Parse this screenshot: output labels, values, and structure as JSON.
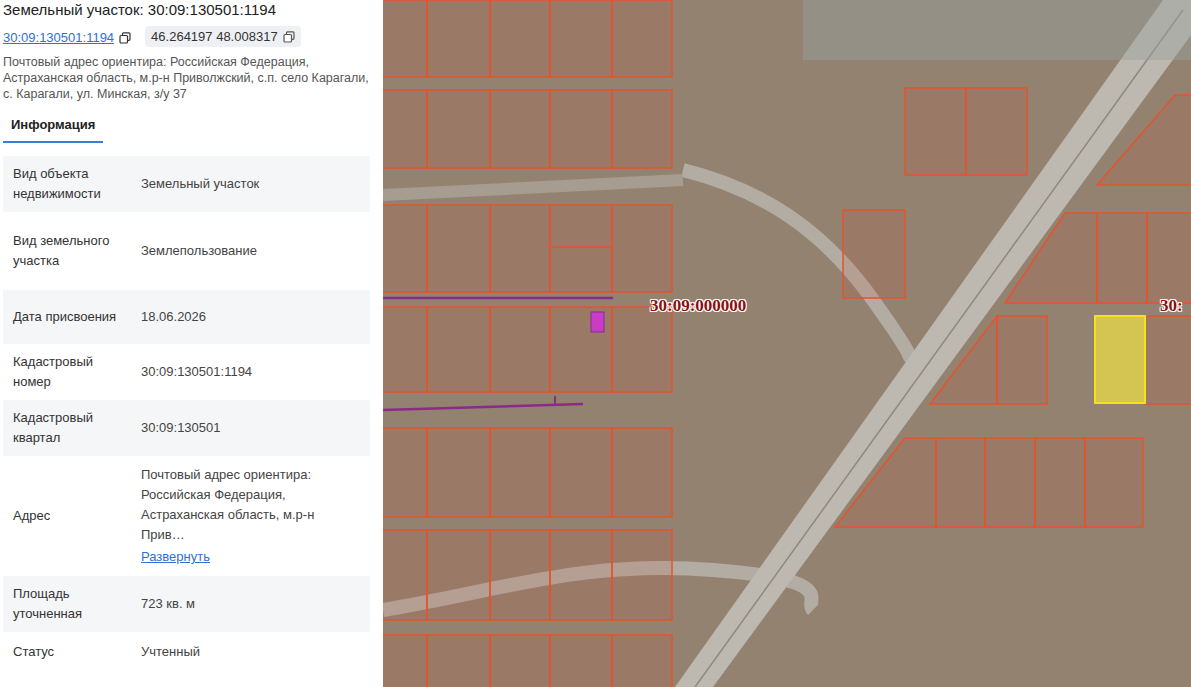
{
  "title": "Земельный участок: 30:09:130501:1194",
  "chips": [
    {
      "label": "30:09:130501:1194",
      "kind": "link"
    },
    {
      "label": "46.264197 48.008317",
      "kind": "plain"
    }
  ],
  "address_line": "Почтовый адрес ориентира: Российская Федерация, Астраханская область, м.р-н Приволжский, с.п. село Карагали, с. Карагали, ул. Минская, з/у 37",
  "tabs": [
    {
      "label": "Информация",
      "selected": true
    }
  ],
  "fields": [
    {
      "label": "Вид объекта недвижимости",
      "value": "Земельный участок",
      "kind": "text"
    },
    {
      "label": "Вид земельного участка",
      "value": "Землепользование",
      "kind": "text"
    },
    {
      "label": "Дата присвоения",
      "value": "18.06.2026",
      "kind": "text"
    },
    {
      "label": "Кадастровый номер",
      "value": "30:09:130501:1194",
      "kind": "text"
    },
    {
      "label": "Кадастровый квартал",
      "value": "30:09:130501",
      "kind": "text"
    },
    {
      "label": "Адрес",
      "value": "Почтовый адрес ориентира: Российская Федерация, Астраханская область, м.р-н Прив…",
      "kind": "expandable",
      "link": "Развернуть"
    },
    {
      "label": "Площадь уточненная",
      "value": "723 кв. м",
      "kind": "text"
    },
    {
      "label": "Статус",
      "value": "Учтенный",
      "kind": "text"
    }
  ],
  "map": {
    "quarter_labels": [
      {
        "text": "30:09:000000"
      },
      {
        "text": "30:"
      }
    ],
    "highlight": {
      "selected": true
    }
  }
}
